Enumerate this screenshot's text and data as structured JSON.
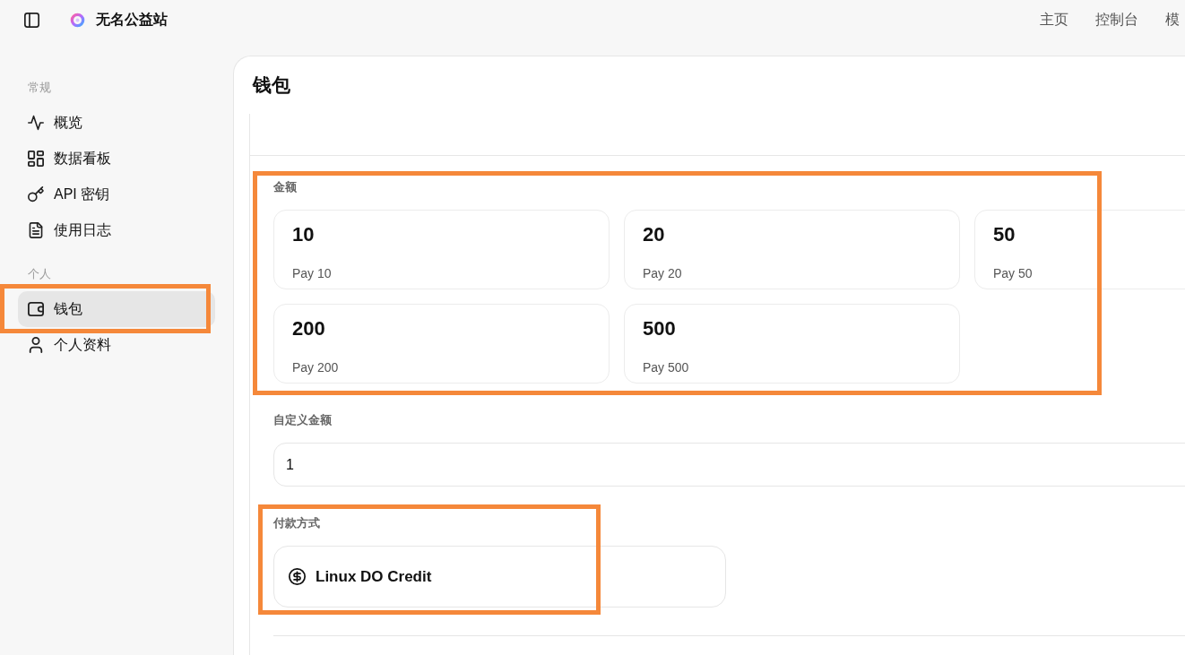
{
  "header": {
    "brand": "无名公益站",
    "nav": [
      {
        "label": "主页"
      },
      {
        "label": "控制台"
      },
      {
        "label": "模"
      }
    ]
  },
  "sidebar": {
    "sections": [
      {
        "title": "常规",
        "items": [
          {
            "label": "概览",
            "selected": false,
            "highlighted": false
          },
          {
            "label": "数据看板",
            "selected": false,
            "highlighted": false
          },
          {
            "label": "API 密钥",
            "selected": false,
            "highlighted": false
          },
          {
            "label": "使用日志",
            "selected": false,
            "highlighted": false
          }
        ]
      },
      {
        "title": "个人",
        "items": [
          {
            "label": "钱包",
            "selected": true,
            "highlighted": true
          },
          {
            "label": "个人资料",
            "selected": false,
            "highlighted": false
          }
        ]
      }
    ]
  },
  "panel": {
    "title": "钱包",
    "amounts": {
      "label": "金额",
      "highlighted": true,
      "options": [
        {
          "amount": "10",
          "caption": "Pay 10",
          "selected": false
        },
        {
          "amount": "20",
          "caption": "Pay 20",
          "selected": false
        },
        {
          "amount": "50",
          "caption": "Pay 50",
          "selected": false
        },
        {
          "amount": "200",
          "caption": "Pay 200",
          "selected": false
        },
        {
          "amount": "500",
          "caption": "Pay 500",
          "selected": false
        }
      ]
    },
    "custom_amount": {
      "label": "自定义金额",
      "value": "1"
    },
    "payment": {
      "label": "付款方式",
      "highlighted": true,
      "methods": [
        {
          "label": "Linux DO Credit",
          "selected": false
        }
      ]
    }
  }
}
